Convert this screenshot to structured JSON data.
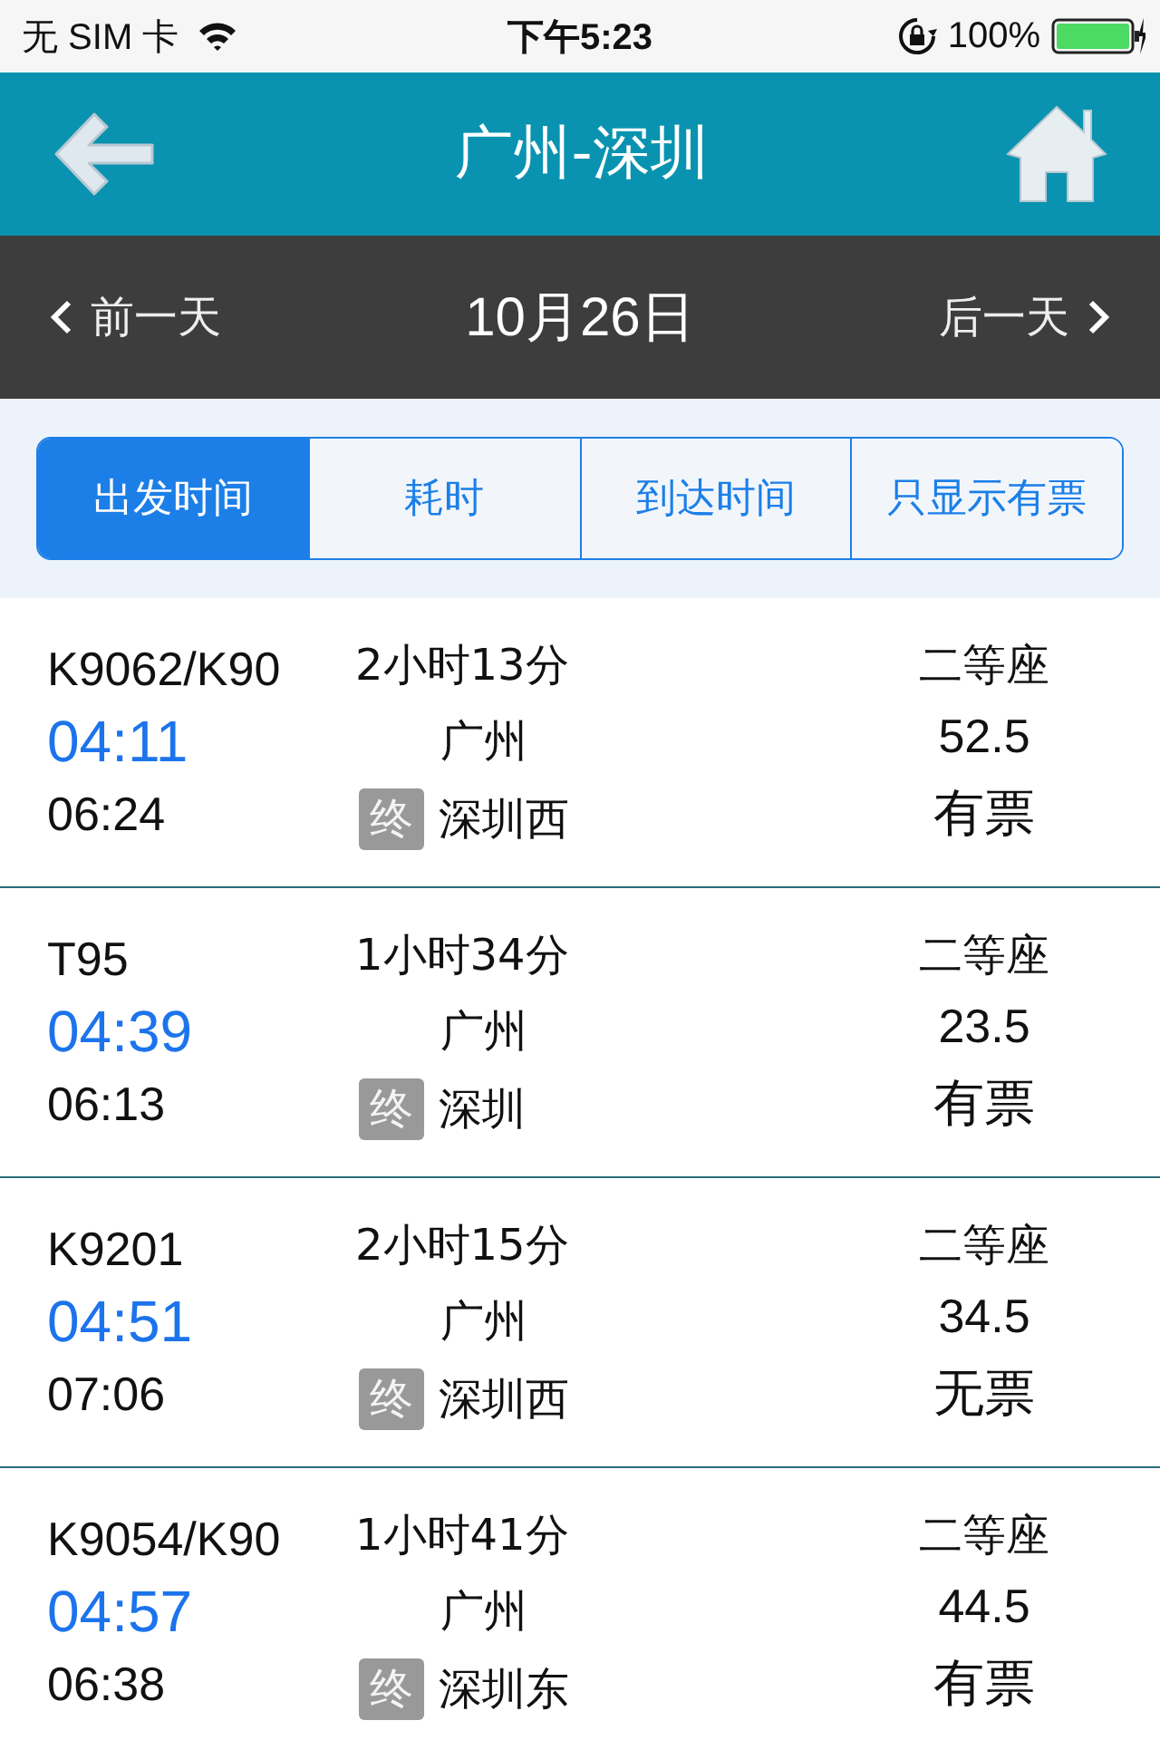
{
  "status_bar": {
    "carrier": "无 SIM 卡",
    "time": "下午5:23",
    "battery": "100%"
  },
  "header": {
    "title": "广州-深圳"
  },
  "date_bar": {
    "prev": "前一天",
    "date": "10月26日",
    "next": "后一天"
  },
  "tabs": [
    {
      "label": "出发时间",
      "selected": true
    },
    {
      "label": "耗时",
      "selected": false
    },
    {
      "label": "到达时间",
      "selected": false
    },
    {
      "label": "只显示有票",
      "selected": false
    }
  ],
  "trains": [
    {
      "number": "K9062/K90",
      "depart": "04:11",
      "arrive": "06:24",
      "duration": "2小时13分",
      "from": "广州",
      "badge": "终",
      "to": "深圳西",
      "seat": "二等座",
      "price": "52.5",
      "availability": "有票"
    },
    {
      "number": "T95",
      "depart": "04:39",
      "arrive": "06:13",
      "duration": "1小时34分",
      "from": "广州",
      "badge": "终",
      "to": "深圳",
      "seat": "二等座",
      "price": "23.5",
      "availability": "有票"
    },
    {
      "number": "K9201",
      "depart": "04:51",
      "arrive": "07:06",
      "duration": "2小时15分",
      "from": "广州",
      "badge": "终",
      "to": "深圳西",
      "seat": "二等座",
      "price": "34.5",
      "availability": "无票"
    },
    {
      "number": "K9054/K90",
      "depart": "04:57",
      "arrive": "06:38",
      "duration": "1小时41分",
      "from": "广州",
      "badge": "终",
      "to": "深圳东",
      "seat": "二等座",
      "price": "44.5",
      "availability": "有票"
    }
  ]
}
